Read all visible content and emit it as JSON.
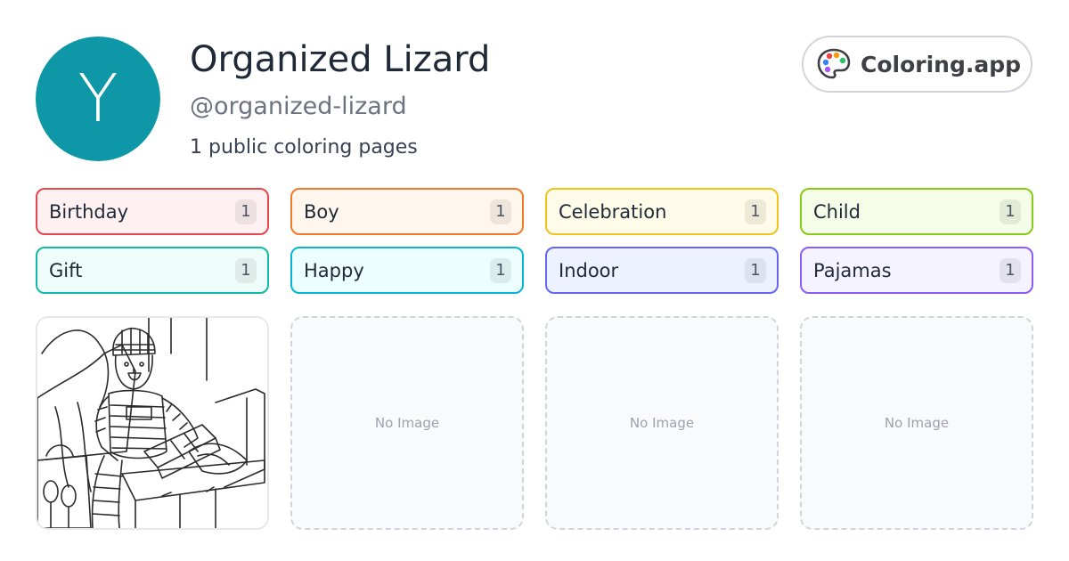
{
  "profile": {
    "avatar_initial": "Y",
    "name": "Organized Lizard",
    "handle": "@organized-lizard",
    "page_count_text": "1 public coloring pages"
  },
  "brand": {
    "icon": "palette-icon",
    "label": "Coloring.app"
  },
  "colors": {
    "avatar": "#0e97a6"
  },
  "tags": [
    {
      "label": "Birthday",
      "count": "1",
      "border": "#e5484d",
      "bg": "#fff1f2"
    },
    {
      "label": "Boy",
      "count": "1",
      "border": "#f2792b",
      "bg": "#fff6ed"
    },
    {
      "label": "Celebration",
      "count": "1",
      "border": "#f1c21b",
      "bg": "#fefbe8"
    },
    {
      "label": "Child",
      "count": "1",
      "border": "#84cc16",
      "bg": "#f5fde8"
    },
    {
      "label": "Gift",
      "count": "1",
      "border": "#14b8a6",
      "bg": "#effdfa"
    },
    {
      "label": "Happy",
      "count": "1",
      "border": "#06b6d4",
      "bg": "#ecfeff"
    },
    {
      "label": "Indoor",
      "count": "1",
      "border": "#6366f1",
      "bg": "#eef2ff"
    },
    {
      "label": "Pajamas",
      "count": "1",
      "border": "#8b5cf6",
      "bg": "#f5f3ff"
    }
  ],
  "pages": [
    {
      "type": "image",
      "subject": "child in pajamas opening a gift on a couch",
      "icon": "coloring-page-thumbnail"
    },
    {
      "type": "empty",
      "label": "No Image"
    },
    {
      "type": "empty",
      "label": "No Image"
    },
    {
      "type": "empty",
      "label": "No Image"
    }
  ]
}
